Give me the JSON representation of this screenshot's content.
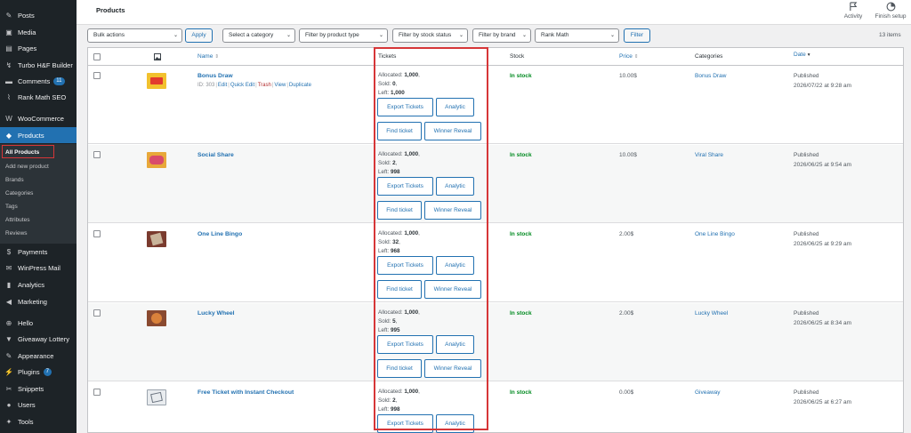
{
  "sidebar": {
    "items": [
      {
        "label": "Posts",
        "icon": "pin-icon"
      },
      {
        "label": "Media",
        "icon": "media-icon"
      },
      {
        "label": "Pages",
        "icon": "pages-icon"
      },
      {
        "label": "Turbo H&F Builder",
        "icon": "builder-icon"
      },
      {
        "label": "Comments",
        "icon": "comment-icon",
        "badge": "11"
      },
      {
        "label": "Rank Math SEO",
        "icon": "chart-icon"
      },
      {
        "label": "WooCommerce",
        "icon": "woocommerce-icon"
      },
      {
        "label": "Products",
        "icon": "products-icon",
        "active": true
      },
      {
        "label": "Payments",
        "icon": "payments-icon"
      },
      {
        "label": "WinPress Mail",
        "icon": "mail-icon"
      },
      {
        "label": "Analytics",
        "icon": "analytics-icon"
      },
      {
        "label": "Marketing",
        "icon": "megaphone-icon"
      },
      {
        "label": "Hello",
        "icon": "plus-icon"
      },
      {
        "label": "Giveaway Lottery",
        "icon": "lottery-icon"
      },
      {
        "label": "Appearance",
        "icon": "brush-icon"
      },
      {
        "label": "Plugins",
        "icon": "plugin-icon",
        "badge": "7"
      },
      {
        "label": "Snippets",
        "icon": "scissors-icon"
      },
      {
        "label": "Users",
        "icon": "user-icon"
      },
      {
        "label": "Tools",
        "icon": "wrench-icon"
      }
    ],
    "submenu": [
      "All Products",
      "Add new product",
      "Brands",
      "Categories",
      "Tags",
      "Attributes",
      "Reviews"
    ]
  },
  "topbar": {
    "title": "Products",
    "activity": "Activity",
    "finish_setup": "Finish setup"
  },
  "filters": {
    "bulk_actions": "Bulk actions",
    "apply": "Apply",
    "category": "Select a category",
    "product_type": "Filter by product type",
    "stock_status": "Filter by stock status",
    "brand": "Filter by brand",
    "rank_math": "Rank Math",
    "filter": "Filter",
    "items_count": "13 items"
  },
  "columns": {
    "name": "Name",
    "tickets": "Tickets",
    "stock": "Stock",
    "price": "Price",
    "categories": "Categories",
    "date": "Date"
  },
  "ticket_labels": {
    "allocated": "Allocated:",
    "sold": "Sold:",
    "left": "Left:",
    "export": "Export Tickets",
    "analytic": "Analytic",
    "find": "Find ticket",
    "winner": "Winner Reveal"
  },
  "products": [
    {
      "name": "Bonus Draw",
      "id": "ID: 303",
      "actions": [
        "Edit",
        "Quick Edit",
        "Trash",
        "View",
        "Duplicate"
      ],
      "allocated": "1,000",
      "sold": "0",
      "left": "1,000",
      "stock": "In stock",
      "price": "10.00$",
      "category": "Bonus Draw",
      "status": "Published",
      "date": "2026/07/22 at 9:28 am",
      "thumb_color": "#f2c12e"
    },
    {
      "name": "Social Share",
      "allocated": "1,000",
      "sold": "2",
      "left": "998",
      "stock": "In stock",
      "price": "10.00$",
      "category": "Viral Share",
      "status": "Published",
      "date": "2026/06/25 at 9:54 am",
      "thumb_color": "#e8a83a"
    },
    {
      "name": "One Line Bingo",
      "allocated": "1,000",
      "sold": "32",
      "left": "968",
      "stock": "In stock",
      "price": "2.00$",
      "category": "One Line Bingo",
      "status": "Published",
      "date": "2026/06/25 at 9:29 am",
      "thumb_color": "#7a3b2e"
    },
    {
      "name": "Lucky Wheel",
      "allocated": "1,000",
      "sold": "5",
      "left": "995",
      "stock": "In stock",
      "price": "2.00$",
      "category": "Lucky Wheel",
      "status": "Published",
      "date": "2026/06/25 at 8:34 am",
      "thumb_color": "#8a4a30"
    },
    {
      "name": "Free Ticket with Instant Checkout",
      "allocated": "1,000",
      "sold": "2",
      "left": "998",
      "stock": "In stock",
      "price": "0.00$",
      "category": "Giveaway",
      "status": "Published",
      "date": "2026/06/25 at 6:27 am",
      "thumb_color": "#9aa3ad"
    }
  ]
}
